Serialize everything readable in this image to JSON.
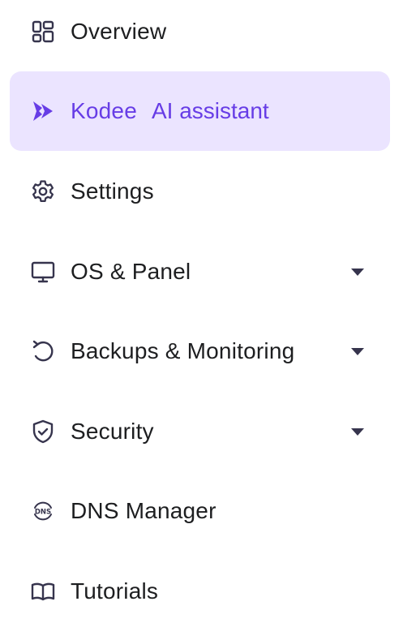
{
  "sidebar": {
    "items": [
      {
        "label": "Overview",
        "icon": "overview-grid-icon"
      },
      {
        "label": "Kodee",
        "sublabel": "AI assistant",
        "icon": "kodee-icon",
        "active": true
      },
      {
        "label": "Settings",
        "icon": "gear-icon"
      },
      {
        "label": "OS & Panel",
        "icon": "monitor-icon",
        "expandable": true
      },
      {
        "label": "Backups & Monitoring",
        "icon": "restore-icon",
        "expandable": true
      },
      {
        "label": "Security",
        "icon": "shield-check-icon",
        "expandable": true
      },
      {
        "label": "DNS Manager",
        "icon": "dns-icon"
      },
      {
        "label": "Tutorials",
        "icon": "book-icon"
      }
    ]
  },
  "colors": {
    "accent": "#673de6",
    "active_bg": "#ebe4ff",
    "text": "#1d1e20",
    "icon": "#36344d"
  }
}
